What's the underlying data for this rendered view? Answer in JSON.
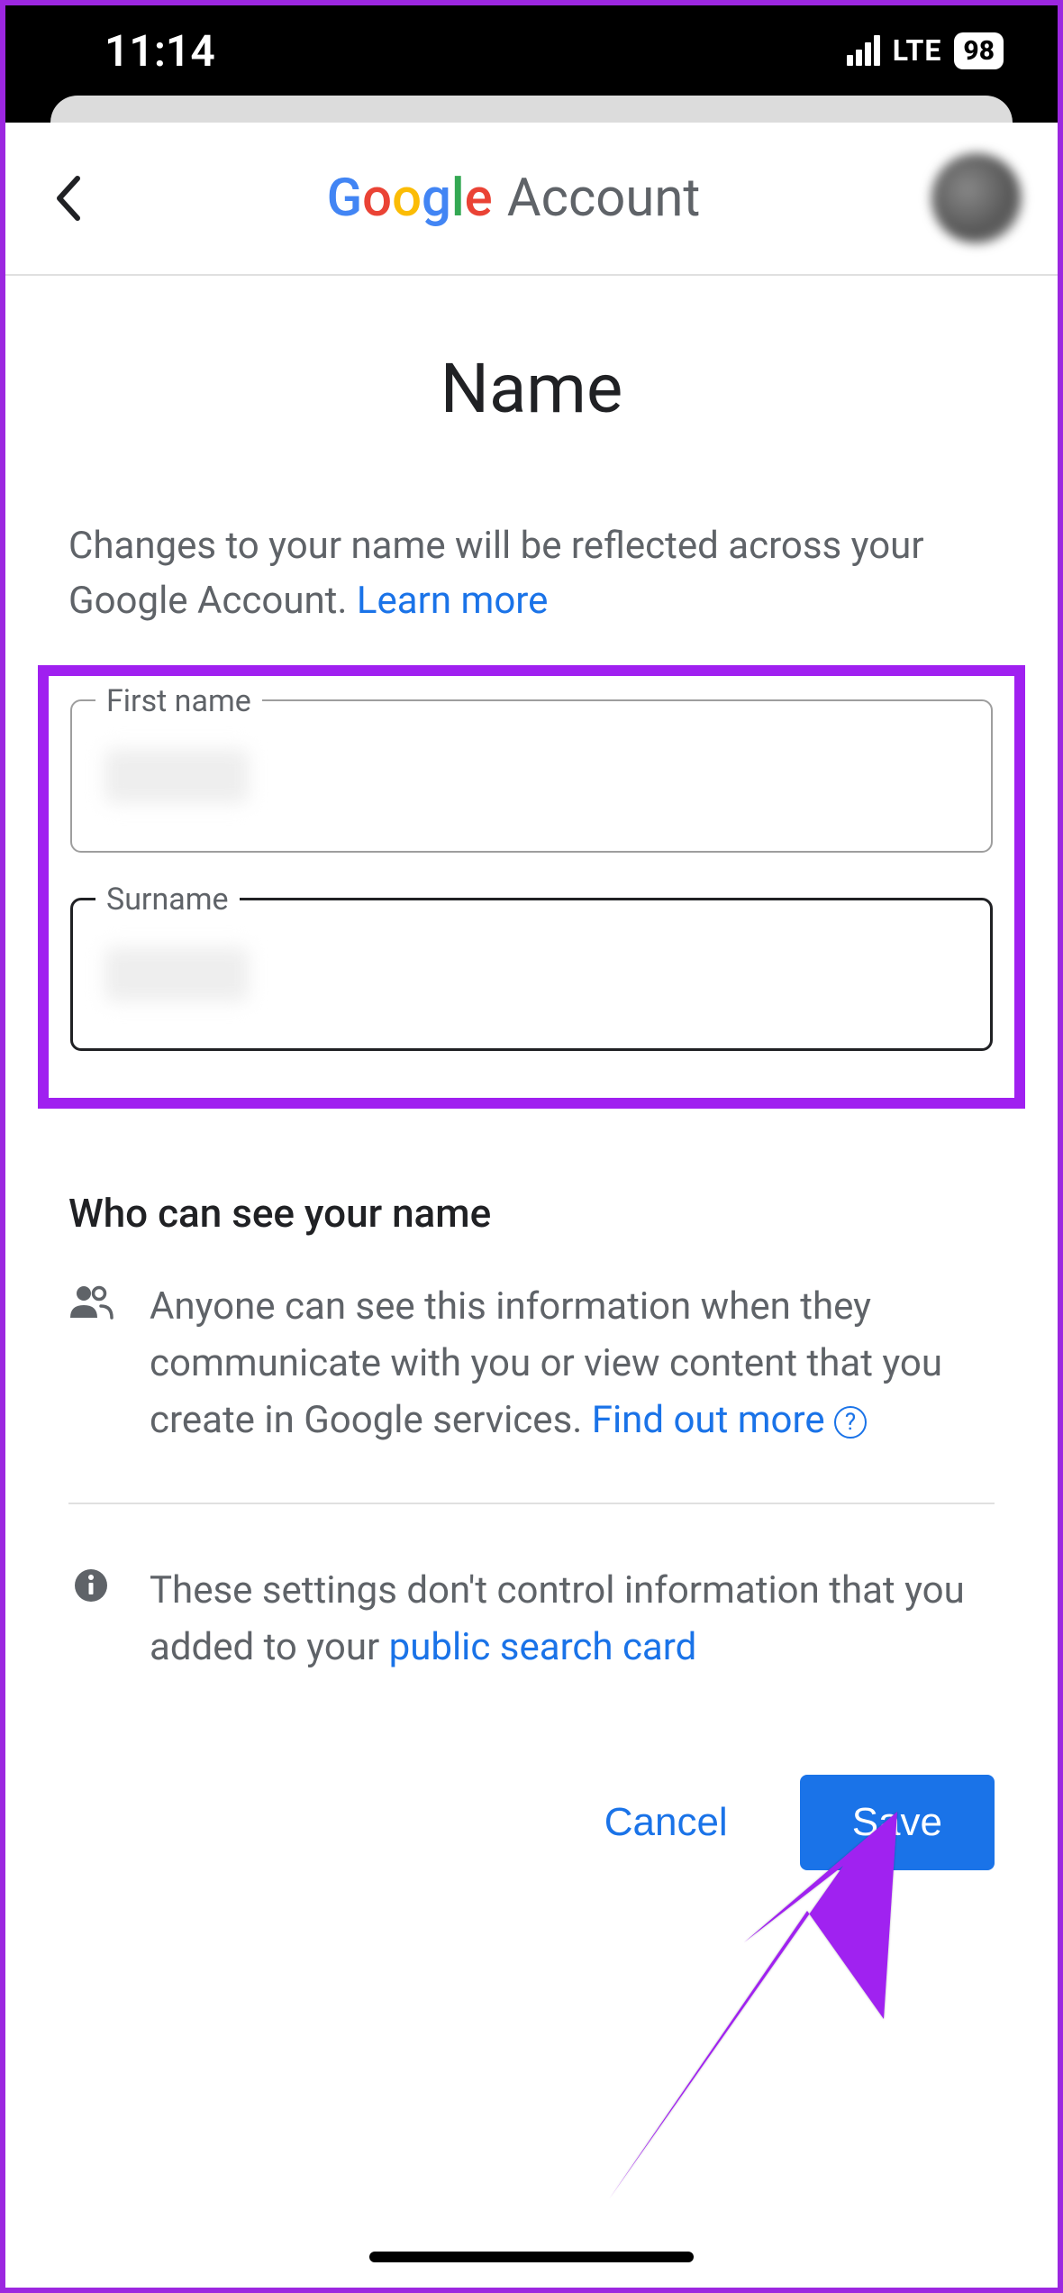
{
  "status": {
    "time": "11:14",
    "network": "LTE",
    "battery": "98"
  },
  "header": {
    "logo_left": "Google",
    "logo_right": "Account"
  },
  "page": {
    "title": "Name",
    "desc_prefix": "Changes to your name will be reflected across your Google Account. ",
    "learn_more": "Learn more"
  },
  "fields": {
    "first_name": {
      "label": "First name",
      "value": ""
    },
    "surname": {
      "label": "Surname",
      "value": ""
    }
  },
  "visibility": {
    "heading": "Who can see your name",
    "body": "Anyone can see this information when they communicate with you or view content that you create in Google services. ",
    "find_out_more": "Find out more"
  },
  "info_note": {
    "prefix": "These settings don't control information that you added to your ",
    "link": "public search card"
  },
  "actions": {
    "cancel": "Cancel",
    "save": "Save"
  }
}
